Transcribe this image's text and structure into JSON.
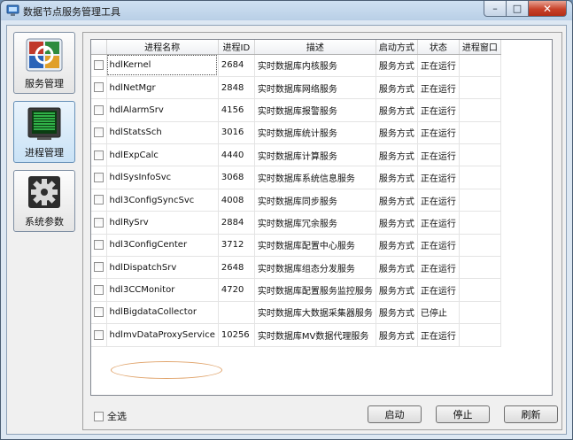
{
  "window": {
    "title": "数据节点服务管理工具",
    "min_glyph": "–",
    "max_glyph": "□",
    "close_glyph": "✕"
  },
  "nav": [
    {
      "label": "服务管理",
      "icon": "services-icon"
    },
    {
      "label": "进程管理",
      "icon": "process-monitor-icon"
    },
    {
      "label": "系统参数",
      "icon": "gear-icon"
    }
  ],
  "table": {
    "headers": [
      "",
      "进程名称",
      "进程ID",
      "描述",
      "启动方式",
      "状态",
      "进程窗口"
    ],
    "rows": [
      {
        "name": "hdlKernel",
        "pid": "2684",
        "desc": "实时数据库内核服务",
        "mode": "服务方式",
        "status": "正在运行"
      },
      {
        "name": "hdlNetMgr",
        "pid": "2848",
        "desc": "实时数据库网络服务",
        "mode": "服务方式",
        "status": "正在运行"
      },
      {
        "name": "hdlAlarmSrv",
        "pid": "4156",
        "desc": "实时数据库报警服务",
        "mode": "服务方式",
        "status": "正在运行"
      },
      {
        "name": "hdlStatsSch",
        "pid": "3016",
        "desc": "实时数据库统计服务",
        "mode": "服务方式",
        "status": "正在运行"
      },
      {
        "name": "hdlExpCalc",
        "pid": "4440",
        "desc": "实时数据库计算服务",
        "mode": "服务方式",
        "status": "正在运行"
      },
      {
        "name": "hdlSysInfoSvc",
        "pid": "3068",
        "desc": "实时数据库系统信息服务",
        "mode": "服务方式",
        "status": "正在运行"
      },
      {
        "name": "hdl3ConfigSyncSvc",
        "pid": "4008",
        "desc": "实时数据库同步服务",
        "mode": "服务方式",
        "status": "正在运行"
      },
      {
        "name": "hdlRySrv",
        "pid": "2884",
        "desc": "实时数据库冗余服务",
        "mode": "服务方式",
        "status": "正在运行"
      },
      {
        "name": "hdl3ConfigCenter",
        "pid": "3712",
        "desc": "实时数据库配置中心服务",
        "mode": "服务方式",
        "status": "正在运行"
      },
      {
        "name": "hdlDispatchSrv",
        "pid": "2648",
        "desc": "实时数据库组态分发服务",
        "mode": "服务方式",
        "status": "正在运行"
      },
      {
        "name": "hdl3CCMonitor",
        "pid": "4720",
        "desc": "实时数据库配置服务监控服务",
        "mode": "服务方式",
        "status": "正在运行"
      },
      {
        "name": "hdlBigdataCollector",
        "pid": "",
        "desc": "实时数据库大数据采集器服务",
        "mode": "服务方式",
        "status": "已停止"
      },
      {
        "name": "hdlmvDataProxyService",
        "pid": "10256",
        "desc": "实时数据库MV数据代理服务",
        "mode": "服务方式",
        "status": "正在运行"
      }
    ]
  },
  "footer": {
    "select_all": "全选",
    "start": "启动",
    "stop": "停止",
    "refresh": "刷新"
  }
}
